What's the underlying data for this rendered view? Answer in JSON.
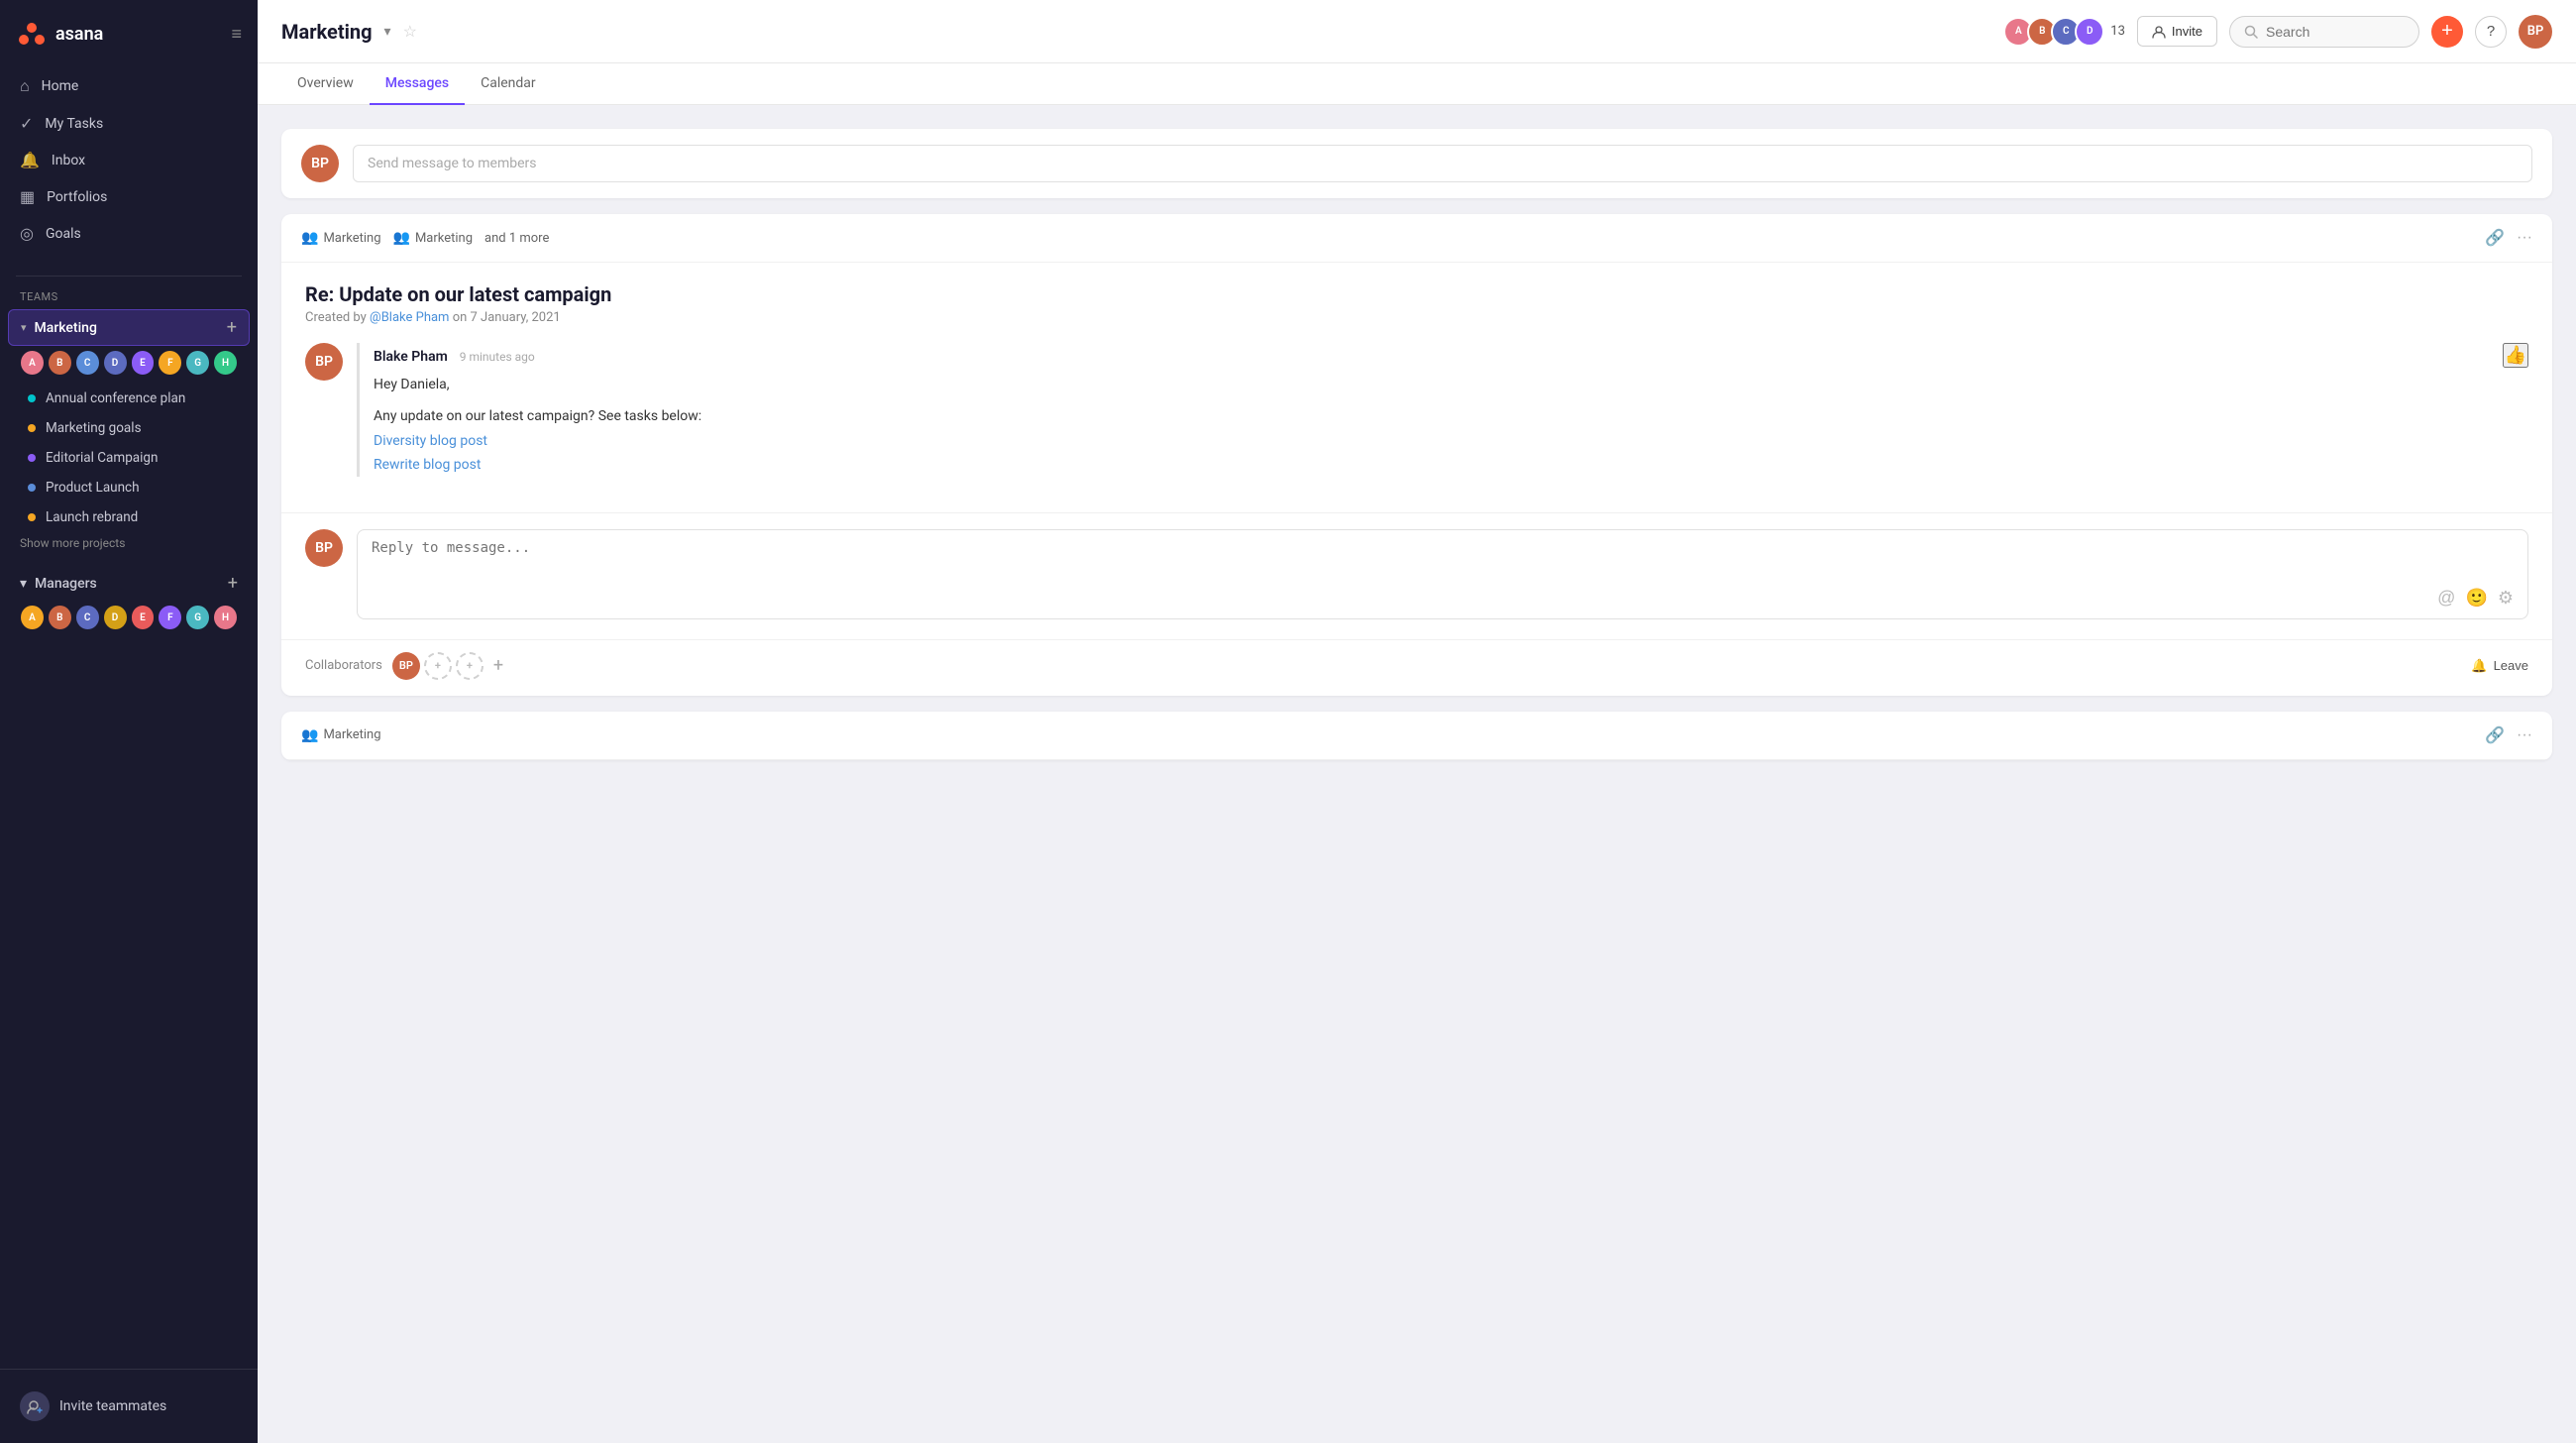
{
  "sidebar": {
    "logo": "asana",
    "nav_items": [
      {
        "id": "home",
        "label": "Home",
        "icon": "⌂"
      },
      {
        "id": "my-tasks",
        "label": "My Tasks",
        "icon": "✓"
      },
      {
        "id": "inbox",
        "label": "Inbox",
        "icon": "🔔"
      },
      {
        "id": "portfolios",
        "label": "Portfolios",
        "icon": "📊"
      },
      {
        "id": "goals",
        "label": "Goals",
        "icon": "◎"
      }
    ],
    "teams_label": "Teams",
    "marketing_team": {
      "name": "Marketing",
      "projects": [
        {
          "id": "annual-conference",
          "label": "Annual conference plan",
          "color": "#00c4cc"
        },
        {
          "id": "marketing-goals",
          "label": "Marketing goals",
          "color": "#f5a623"
        },
        {
          "id": "editorial-campaign",
          "label": "Editorial Campaign",
          "color": "#8b5cf6"
        },
        {
          "id": "product-launch",
          "label": "Product Launch",
          "color": "#5b8dd9"
        },
        {
          "id": "launch-rebrand",
          "label": "Launch rebrand",
          "color": "#f5a623"
        }
      ],
      "show_more": "Show more projects"
    },
    "managers_team": {
      "name": "Managers"
    },
    "invite": {
      "label": "Invite teammates"
    }
  },
  "topbar": {
    "project_title": "Marketing",
    "member_count": "13",
    "invite_label": "Invite",
    "search_placeholder": "Search",
    "user_initials": "BP"
  },
  "tabs": [
    {
      "id": "overview",
      "label": "Overview"
    },
    {
      "id": "messages",
      "label": "Messages",
      "active": true
    },
    {
      "id": "calendar",
      "label": "Calendar"
    }
  ],
  "messages": {
    "compose_placeholder": "Send message to members",
    "threads": [
      {
        "id": "thread-1",
        "header_tags": [
          "Marketing",
          "Marketing",
          "and 1 more"
        ],
        "subject": "Re: Update on our latest campaign",
        "created_by": "@Blake Pham",
        "created_date": "on 7 January, 2021",
        "author": "Blake Pham",
        "time_ago": "9 minutes ago",
        "greeting": "Hey Daniela,",
        "body": "Any update on our latest campaign? See tasks below:",
        "links": [
          {
            "label": "Diversity blog post"
          },
          {
            "label": "Rewrite blog post"
          }
        ],
        "reply_placeholder": "Reply to message...",
        "collaborators_label": "Collaborators",
        "leave_label": "Leave"
      }
    ],
    "second_thread_tag": "Marketing"
  }
}
